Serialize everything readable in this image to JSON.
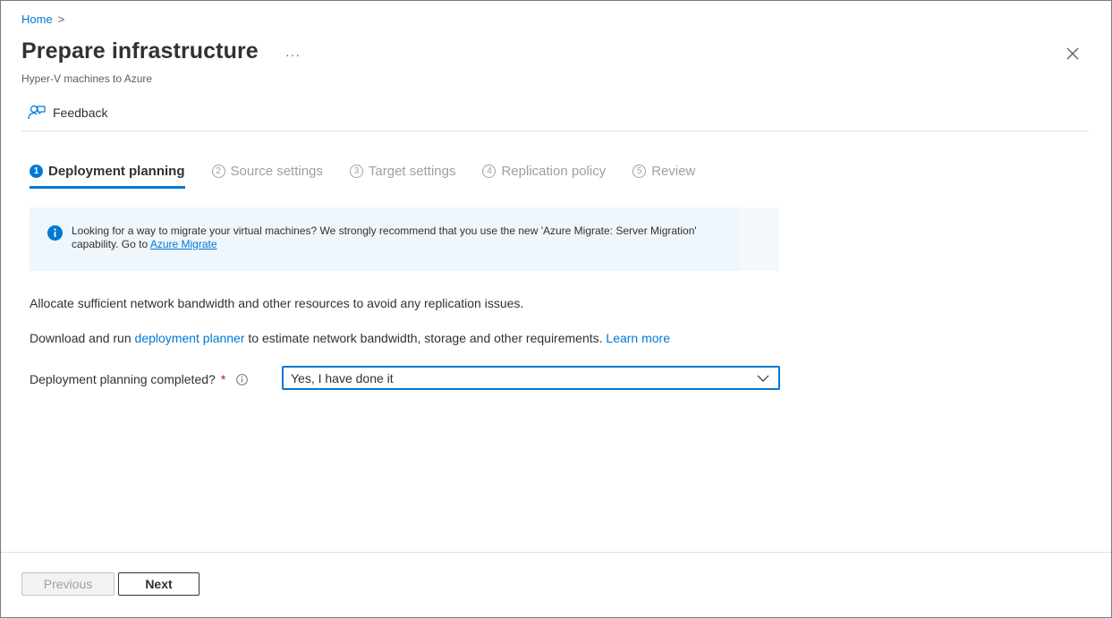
{
  "breadcrumb": {
    "home": "Home",
    "separator": ">"
  },
  "header": {
    "title": "Prepare infrastructure",
    "more": "···",
    "subtitle": "Hyper-V machines to Azure"
  },
  "toolbar": {
    "feedback_label": "Feedback"
  },
  "steps": [
    {
      "num": "1",
      "label": "Deployment planning",
      "active": true
    },
    {
      "num": "2",
      "label": "Source settings",
      "active": false
    },
    {
      "num": "3",
      "label": "Target settings",
      "active": false
    },
    {
      "num": "4",
      "label": "Replication policy",
      "active": false
    },
    {
      "num": "5",
      "label": "Review",
      "active": false
    }
  ],
  "info": {
    "text": "Looking for a way to migrate your virtual machines? We strongly recommend that you use the new 'Azure Migrate: Server Migration' capability. Go to ",
    "link": "Azure Migrate"
  },
  "content": {
    "para1": "Allocate sufficient network bandwidth and other resources to avoid any replication issues.",
    "para2_prefix": "Download and run ",
    "para2_link1": "deployment planner",
    "para2_mid": " to estimate network bandwidth, storage and other requirements. ",
    "para2_link2": "Learn more"
  },
  "field": {
    "label": "Deployment planning completed?",
    "required_mark": "*",
    "value": "Yes, I have done it"
  },
  "footer": {
    "previous": "Previous",
    "next": "Next"
  },
  "colors": {
    "accent": "#0078d4",
    "required": "#a4262c",
    "info_bg": "#eff6fc"
  },
  "icons": [
    "chevron-right-icon",
    "more-icon",
    "close-icon",
    "feedback-icon",
    "info-icon",
    "chevron-down-icon"
  ]
}
